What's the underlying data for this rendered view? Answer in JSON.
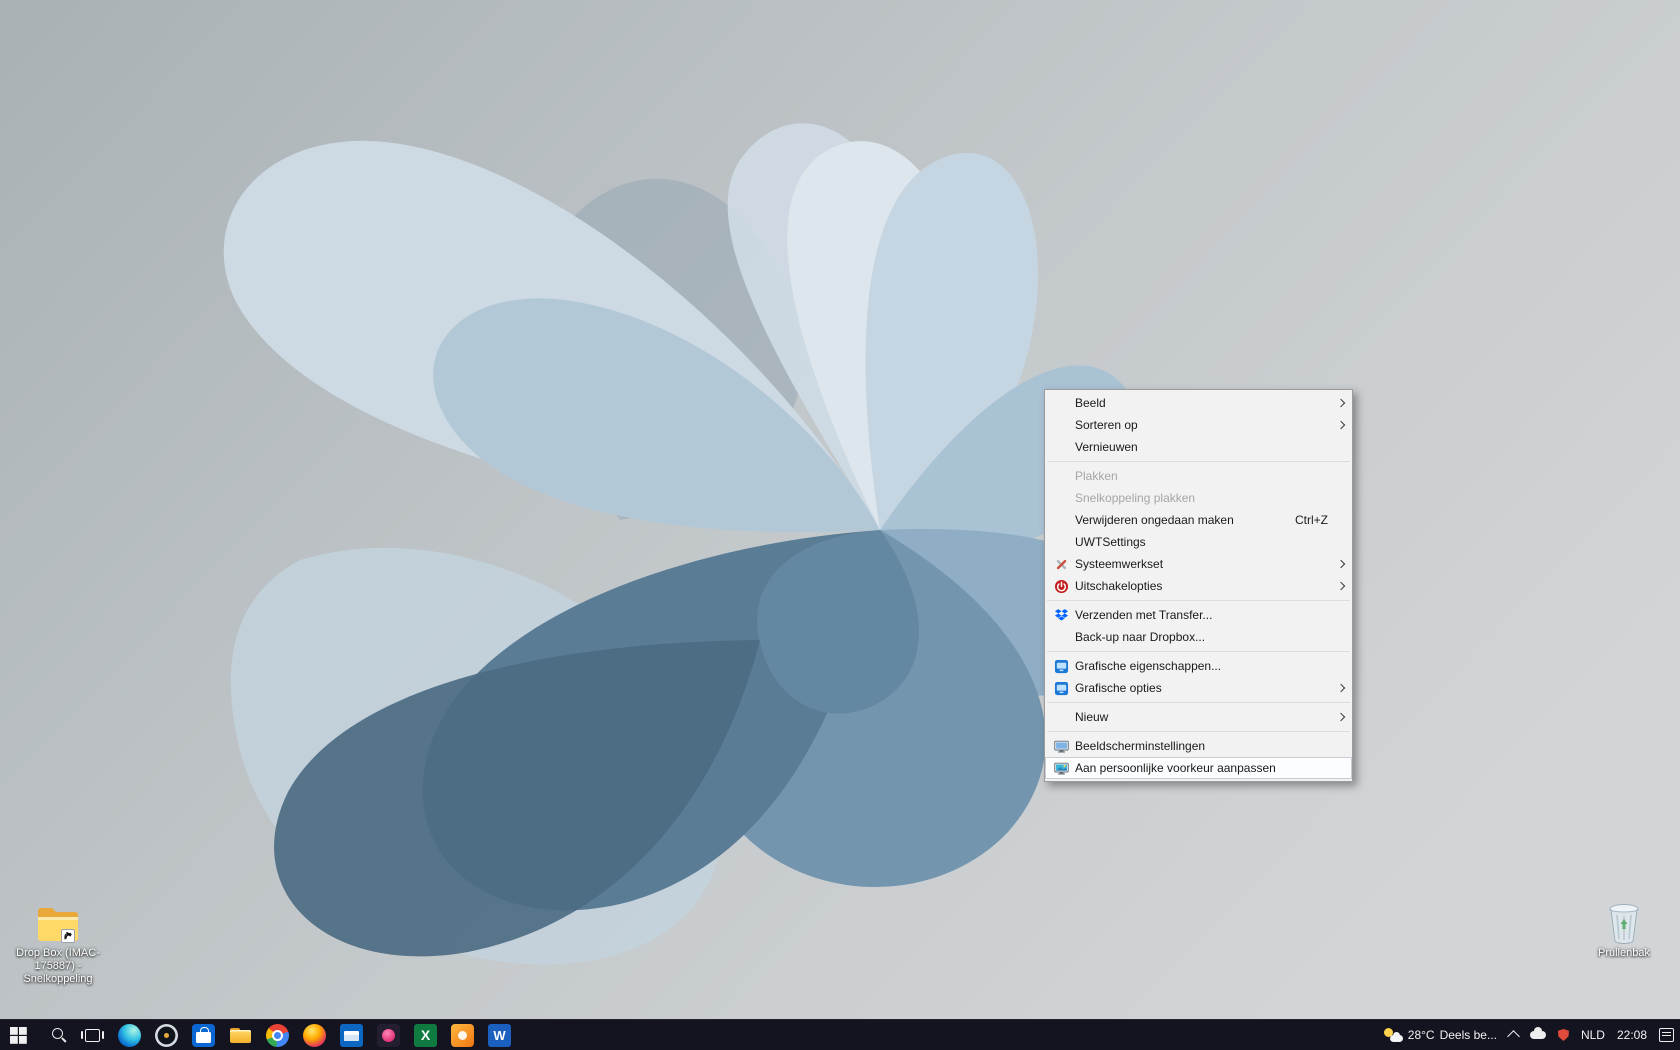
{
  "desktop_icons": [
    {
      "name": "dropbox-shortcut",
      "label": "Drop Box (IMAC-175887) - Snelkoppeling"
    },
    {
      "name": "recycle-bin",
      "label": "Prullenbak"
    }
  ],
  "context_menu": {
    "items": [
      {
        "label": "Beeld",
        "submenu": true
      },
      {
        "label": "Sorteren op",
        "submenu": true
      },
      {
        "label": "Vernieuwen"
      },
      {
        "separator": true
      },
      {
        "label": "Plakken",
        "disabled": true
      },
      {
        "label": "Snelkoppeling plakken",
        "disabled": true
      },
      {
        "label": "Verwijderen ongedaan maken",
        "shortcut": "Ctrl+Z"
      },
      {
        "label": "UWTSettings"
      },
      {
        "label": "Systeemwerkset",
        "icon": "systemtools-icon",
        "submenu": true
      },
      {
        "label": "Uitschakelopties",
        "icon": "power-icon",
        "submenu": true
      },
      {
        "separator": true
      },
      {
        "label": "Verzenden met Transfer...",
        "icon": "dropbox-transfer-icon"
      },
      {
        "label": "Back-up naar Dropbox..."
      },
      {
        "separator": true
      },
      {
        "label": "Grafische eigenschappen...",
        "icon": "intel-graphics-icon"
      },
      {
        "label": "Grafische opties",
        "icon": "intel-graphics-icon",
        "submenu": true
      },
      {
        "separator": true
      },
      {
        "label": "Nieuw",
        "submenu": true
      },
      {
        "separator": true
      },
      {
        "label": "Beeldscherminstellingen",
        "icon": "display-settings-icon"
      },
      {
        "label": "Aan persoonlijke voorkeur aanpassen",
        "icon": "personalization-icon",
        "highlighted": true
      }
    ]
  },
  "taskbar": {
    "apps": [
      {
        "name": "edge"
      },
      {
        "name": "utility"
      },
      {
        "name": "store"
      },
      {
        "name": "explorer"
      },
      {
        "name": "chrome"
      },
      {
        "name": "firefox"
      },
      {
        "name": "outlook"
      },
      {
        "name": "media"
      },
      {
        "name": "excel"
      },
      {
        "name": "orange"
      },
      {
        "name": "word"
      }
    ],
    "tray": {
      "temperature": "28°C",
      "condition": "Deels be...",
      "language": "NLD",
      "time": "22:08"
    }
  }
}
